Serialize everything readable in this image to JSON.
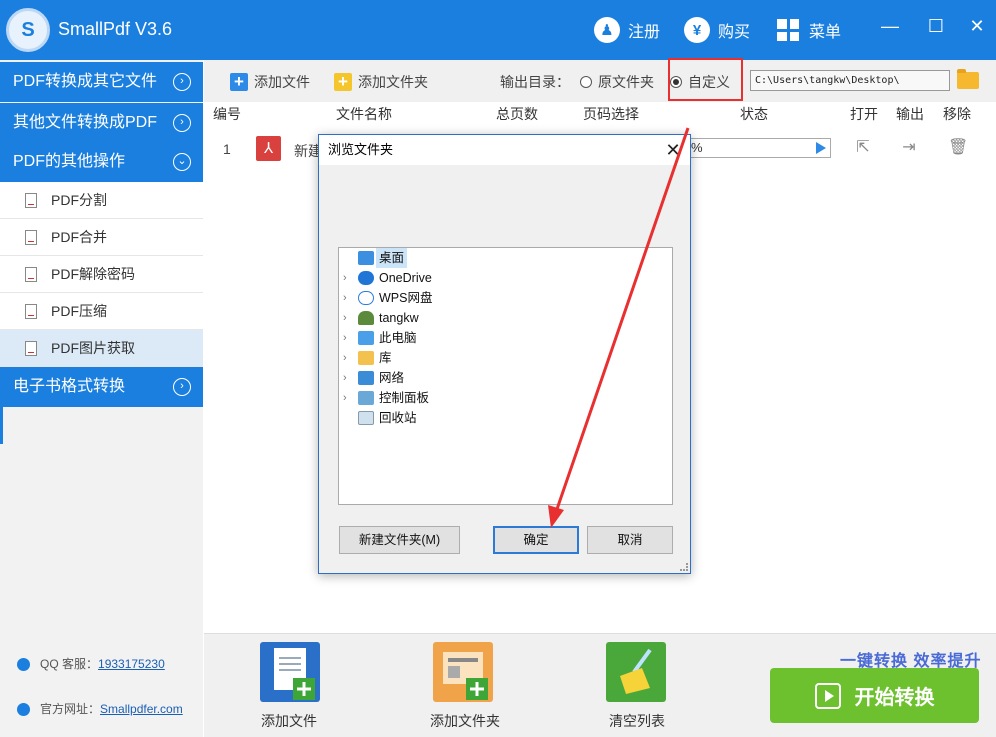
{
  "app": {
    "title": "SmallPdf V3.6"
  },
  "titlebar": {
    "register": "注册",
    "buy": "购买",
    "menu": "菜单",
    "minimize": "—",
    "maximize": "☐",
    "close": "✕"
  },
  "sidebar": {
    "sections": [
      {
        "label": "PDF转换成其它文件"
      },
      {
        "label": "其他文件转换成PDF"
      },
      {
        "label": "PDF的其他操作"
      }
    ],
    "items": [
      {
        "label": "PDF分割"
      },
      {
        "label": "PDF合并"
      },
      {
        "label": "PDF解除密码"
      },
      {
        "label": "PDF压缩"
      },
      {
        "label": "PDF图片获取"
      }
    ],
    "ebook": {
      "label": "电子书格式转换"
    },
    "qq_label": "QQ 客服：",
    "qq_value": "1933175230",
    "site_label": "官方网址：",
    "site_value": "Smallpdfer.com"
  },
  "toolbar": {
    "add_file": "添加文件",
    "add_folder": "添加文件夹",
    "output_label": "输出目录：",
    "option_original": "原文件夹",
    "option_custom": "自定义",
    "path": "C:\\Users\\tangkw\\Desktop\\"
  },
  "table": {
    "headers": [
      "编号",
      "文件名称",
      "总页数",
      "页码选择",
      "状态",
      "打开",
      "输出",
      "移除"
    ],
    "rows": [
      {
        "num": "1",
        "name": "新建",
        "status": "%"
      }
    ]
  },
  "dialog": {
    "title": "浏览文件夹",
    "tree": [
      {
        "label": "桌面",
        "icon": "desktop-icon",
        "expandable": false,
        "selected": true
      },
      {
        "label": "OneDrive",
        "icon": "cloud-icon",
        "expandable": true
      },
      {
        "label": "WPS网盘",
        "icon": "cloud-outline-icon",
        "expandable": true
      },
      {
        "label": "tangkw",
        "icon": "user-icon",
        "expandable": true
      },
      {
        "label": "此电脑",
        "icon": "computer-icon",
        "expandable": true
      },
      {
        "label": "库",
        "icon": "library-folder-icon",
        "expandable": true
      },
      {
        "label": "网络",
        "icon": "network-icon",
        "expandable": true
      },
      {
        "label": "控制面板",
        "icon": "control-panel-icon",
        "expandable": true
      },
      {
        "label": "回收站",
        "icon": "recycle-bin-icon",
        "expandable": false
      }
    ],
    "new_folder": "新建文件夹(M)",
    "ok": "确定",
    "cancel": "取消"
  },
  "bottom": {
    "add_file": "添加文件",
    "add_folder": "添加文件夹",
    "clear_list": "清空列表",
    "slogan": "一键转换  效率提升",
    "start": "开始转换"
  },
  "colors": {
    "primary": "#1a7fde",
    "accent_green": "#6dc12e",
    "highlight_red": "#e83030"
  }
}
